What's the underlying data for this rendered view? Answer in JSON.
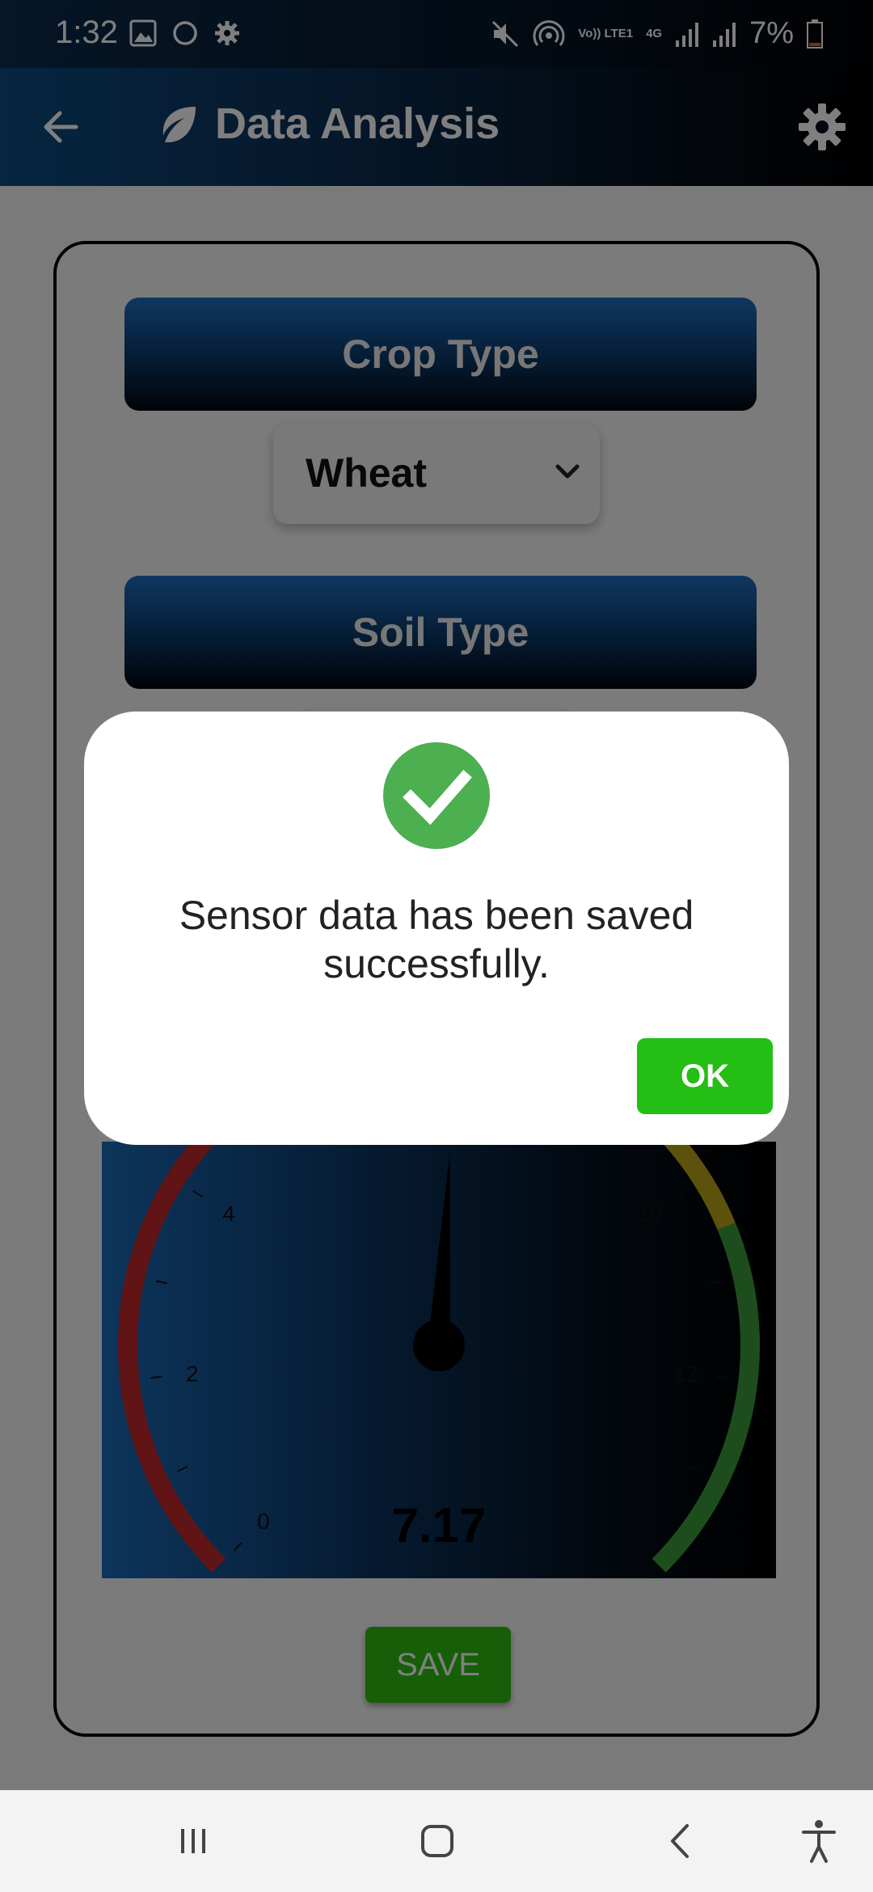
{
  "status_bar": {
    "time": "1:32",
    "network": [
      "Vo)) LTE1",
      "4G"
    ],
    "battery": "7%",
    "icons": [
      "image-icon",
      "circle-icon",
      "gear-icon",
      "mute-icon",
      "hotspot-icon",
      "signal-icon",
      "signal-icon",
      "battery-icon"
    ]
  },
  "app_bar": {
    "title": "Data Analysis",
    "icons": [
      "back-arrow-icon",
      "leaf-icon",
      "gear-icon"
    ]
  },
  "form": {
    "crop_type_label": "Crop Type",
    "crop_type_value": "Wheat",
    "soil_type_label": "Soil Type"
  },
  "gauge": {
    "value": "7.17",
    "value_numeric": 7.17,
    "min": 0,
    "max": 14,
    "tick_labels": [
      "0",
      "2",
      "4",
      "10",
      "12"
    ]
  },
  "save_button": "SAVE",
  "dialog": {
    "message": "Sensor data has been saved successfully.",
    "ok_label": "OK",
    "icon": "check-icon"
  },
  "nav_bar": {
    "icons": [
      "recent-apps-icon",
      "home-icon",
      "back-icon",
      "accessibility-icon"
    ]
  },
  "colors": {
    "accent_blue": "#0e4c83",
    "success_green": "#4caf50",
    "ok_green": "#24be14",
    "gauge_red": "#c0282a",
    "gauge_yellow": "#b8a516",
    "gauge_green": "#3d9a3a"
  }
}
